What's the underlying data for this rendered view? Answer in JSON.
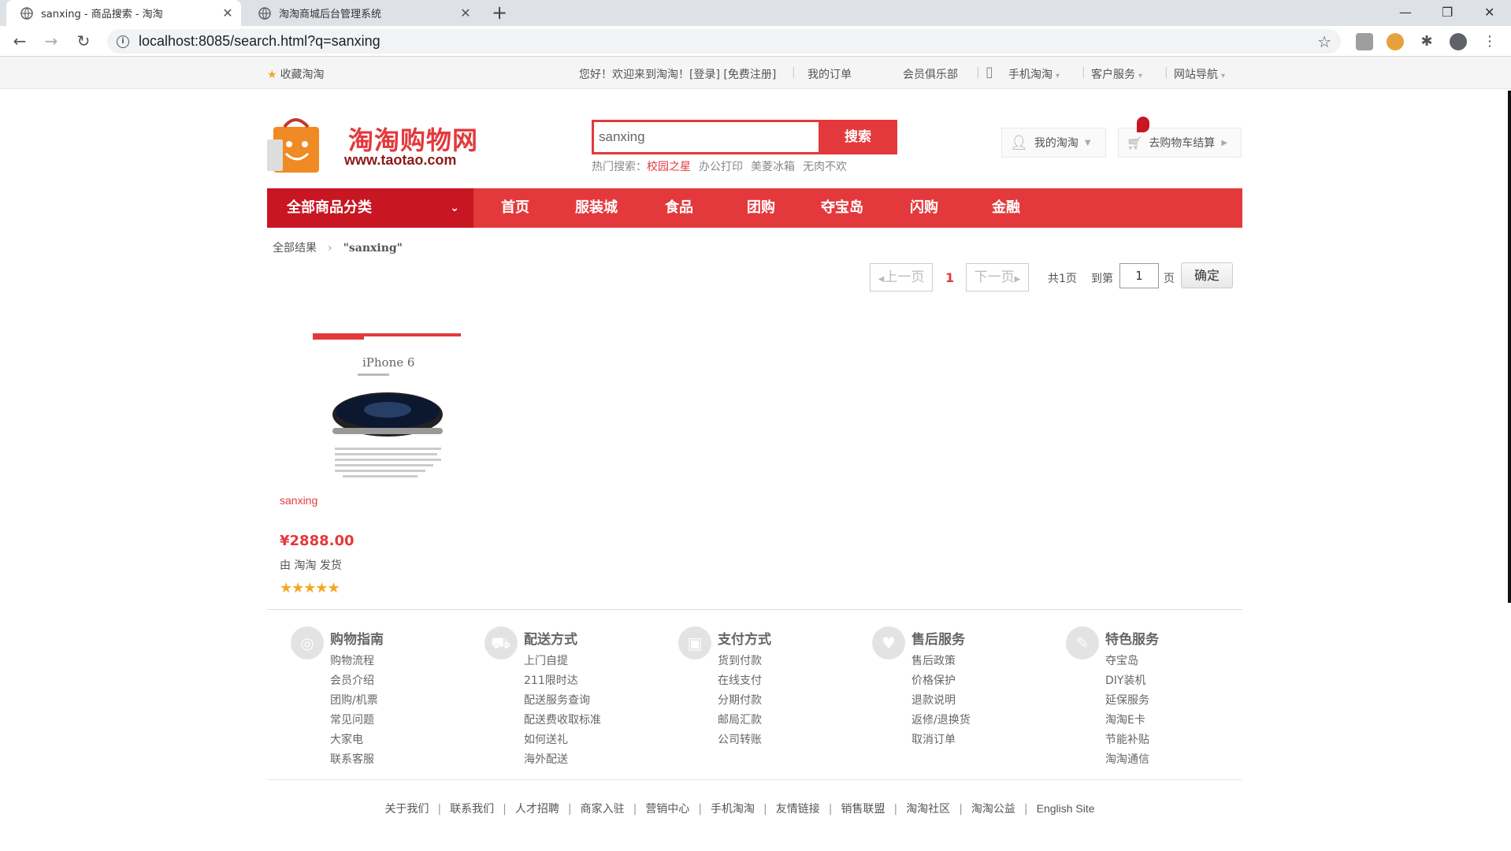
{
  "browser": {
    "tabs": [
      {
        "title": "sanxing - 商品搜索 - 淘淘",
        "active": true
      },
      {
        "title": "淘淘商城后台管理系统",
        "active": false
      }
    ],
    "url": "localhost:8085/search.html?q=sanxing"
  },
  "topbar": {
    "favorite": "收藏淘淘",
    "welcome": "您好！欢迎来到淘淘！[登录] [免费注册]",
    "my_orders": "我的订单",
    "club": "会员俱乐部",
    "mobile": "手机淘淘",
    "service": "客户服务",
    "site_nav": "网站导航"
  },
  "header": {
    "logo_text": "淘淘购物网",
    "logo_url": "www.taotao.com",
    "search_value": "sanxing",
    "search_button": "搜索",
    "hot_label": "热门搜索：",
    "hot_items": [
      "校园之星",
      "办公打印",
      "美菱冰箱",
      "无肉不欢"
    ],
    "my_tao": "我的淘淘",
    "cart": "去购物车结算"
  },
  "nav": {
    "all_categories": "全部商品分类",
    "links": [
      "首页",
      "服装城",
      "食品",
      "团购",
      "夺宝岛",
      "闪购",
      "金融"
    ]
  },
  "breadcrumb": {
    "root": "全部结果",
    "query": "\"sanxing\""
  },
  "pager": {
    "prev": "上一页",
    "current": "1",
    "next": "下一页",
    "total": "共1页",
    "goto": "到第",
    "page_value": "1",
    "page_unit": "页",
    "ok": "确定"
  },
  "products": [
    {
      "image_caption": "iPhone 6",
      "name": "sanxing",
      "price": "¥2888.00",
      "shipper": "由 淘淘 发货",
      "rating": 5
    }
  ],
  "help": [
    {
      "title": "购物指南",
      "icon": "compass-icon",
      "items": [
        "购物流程",
        "会员介绍",
        "团购/机票",
        "常见问题",
        "大家电",
        "联系客服"
      ]
    },
    {
      "title": "配送方式",
      "icon": "truck-icon",
      "items": [
        "上门自提",
        "211限时达",
        "配送服务查询",
        "配送费收取标准",
        "如何送礼",
        "海外配送"
      ]
    },
    {
      "title": "支付方式",
      "icon": "wallet-icon",
      "items": [
        "货到付款",
        "在线支付",
        "分期付款",
        "邮局汇款",
        "公司转账"
      ]
    },
    {
      "title": "售后服务",
      "icon": "heart-icon",
      "items": [
        "售后政策",
        "价格保护",
        "退款说明",
        "返修/退换货",
        "取消订单"
      ]
    },
    {
      "title": "特色服务",
      "icon": "wrench-icon",
      "items": [
        "夺宝岛",
        "DIY装机",
        "延保服务",
        "淘淘E卡",
        "节能补贴",
        "淘淘通信"
      ]
    }
  ],
  "footer_links": [
    "关于我们",
    "联系我们",
    "人才招聘",
    "商家入驻",
    "营销中心",
    "手机淘淘",
    "友情链接",
    "销售联盟",
    "淘淘社区",
    "淘淘公益",
    "English Site"
  ]
}
